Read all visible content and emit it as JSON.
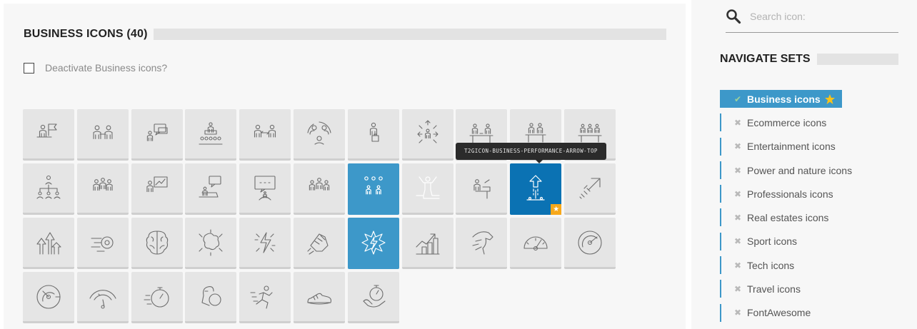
{
  "main": {
    "title": "BUSINESS ICONS (40)",
    "deactivate_label": "Deactivate Business icons?",
    "tooltip": "T2GICON-BUSINESS-PERFORMANCE-ARROW-TOP",
    "icons": [
      "icon-1",
      "icon-2",
      "icon-3",
      "icon-4",
      "icon-5",
      "icon-6",
      "icon-7",
      "icon-8",
      "icon-9",
      "icon-10",
      "icon-11",
      "icon-12",
      "icon-13",
      "icon-14",
      "icon-15",
      "icon-16",
      "icon-17",
      "icon-18",
      "icon-19",
      "icon-20",
      "icon-21",
      "icon-22",
      "icon-23",
      "icon-24",
      "icon-25",
      "icon-26",
      "icon-27",
      "icon-28",
      "icon-29",
      "icon-30",
      "icon-31",
      "icon-32",
      "icon-33",
      "icon-34",
      "icon-35",
      "icon-36",
      "icon-37",
      "icon-38",
      "icon-39",
      "icon-40"
    ]
  },
  "sidebar": {
    "search_placeholder": "Search icon:",
    "nav_title": "NAVIGATE SETS",
    "items": [
      {
        "label": "Business icons",
        "active": true
      },
      {
        "label": "Ecommerce icons"
      },
      {
        "label": "Entertainment icons"
      },
      {
        "label": "Power and nature icons"
      },
      {
        "label": "Professionals icons"
      },
      {
        "label": "Real estates icons"
      },
      {
        "label": "Sport icons"
      },
      {
        "label": "Tech icons"
      },
      {
        "label": "Travel icons"
      },
      {
        "label": "FontAwesome"
      }
    ]
  },
  "colors": {
    "accent": "#3d98c9",
    "hover": "#0b72b3",
    "favorite": "#f7a81b",
    "tile": "#e5e5e5",
    "icon_stroke": "#6d6d6d"
  }
}
